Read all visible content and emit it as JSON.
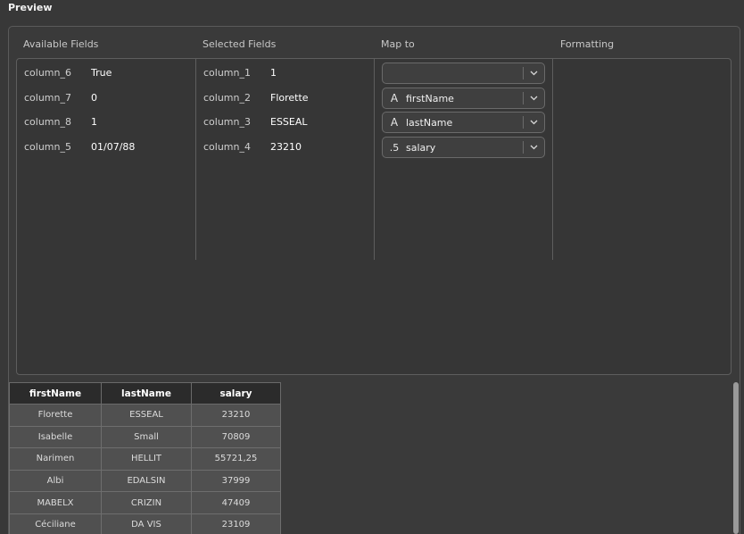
{
  "preview_title": "Preview",
  "headers": {
    "available": "Available Fields",
    "selected": "Selected Fields",
    "map_to": "Map to",
    "formatting": "Formatting"
  },
  "available_fields": [
    {
      "name": "column_6",
      "value": "True"
    },
    {
      "name": "column_7",
      "value": "0"
    },
    {
      "name": "column_8",
      "value": "1"
    },
    {
      "name": "column_5",
      "value": "01/07/88"
    }
  ],
  "selected_fields": [
    {
      "name": "column_1",
      "value": "1"
    },
    {
      "name": "column_2",
      "value": "Florette"
    },
    {
      "name": "column_3",
      "value": "ESSEAL"
    },
    {
      "name": "column_4",
      "value": "23210"
    }
  ],
  "map_to": [
    {
      "type_glyph": "",
      "label": ""
    },
    {
      "type_glyph": "A",
      "label": "firstName"
    },
    {
      "type_glyph": "A",
      "label": "lastName"
    },
    {
      "type_glyph": ".5",
      "label": "salary"
    }
  ],
  "table": {
    "columns": [
      "firstName",
      "lastName",
      "salary"
    ],
    "rows": [
      [
        "Florette",
        "ESSEAL",
        "23210"
      ],
      [
        "Isabelle",
        "Small",
        "70809"
      ],
      [
        "Narimen",
        "HELLIT",
        "55721,25"
      ],
      [
        "Albi",
        "EDALSIN",
        "37999"
      ],
      [
        "MABELX",
        "CRIZIN",
        "47409"
      ],
      [
        "Céciliane",
        "DA VIS",
        "23109"
      ]
    ]
  }
}
